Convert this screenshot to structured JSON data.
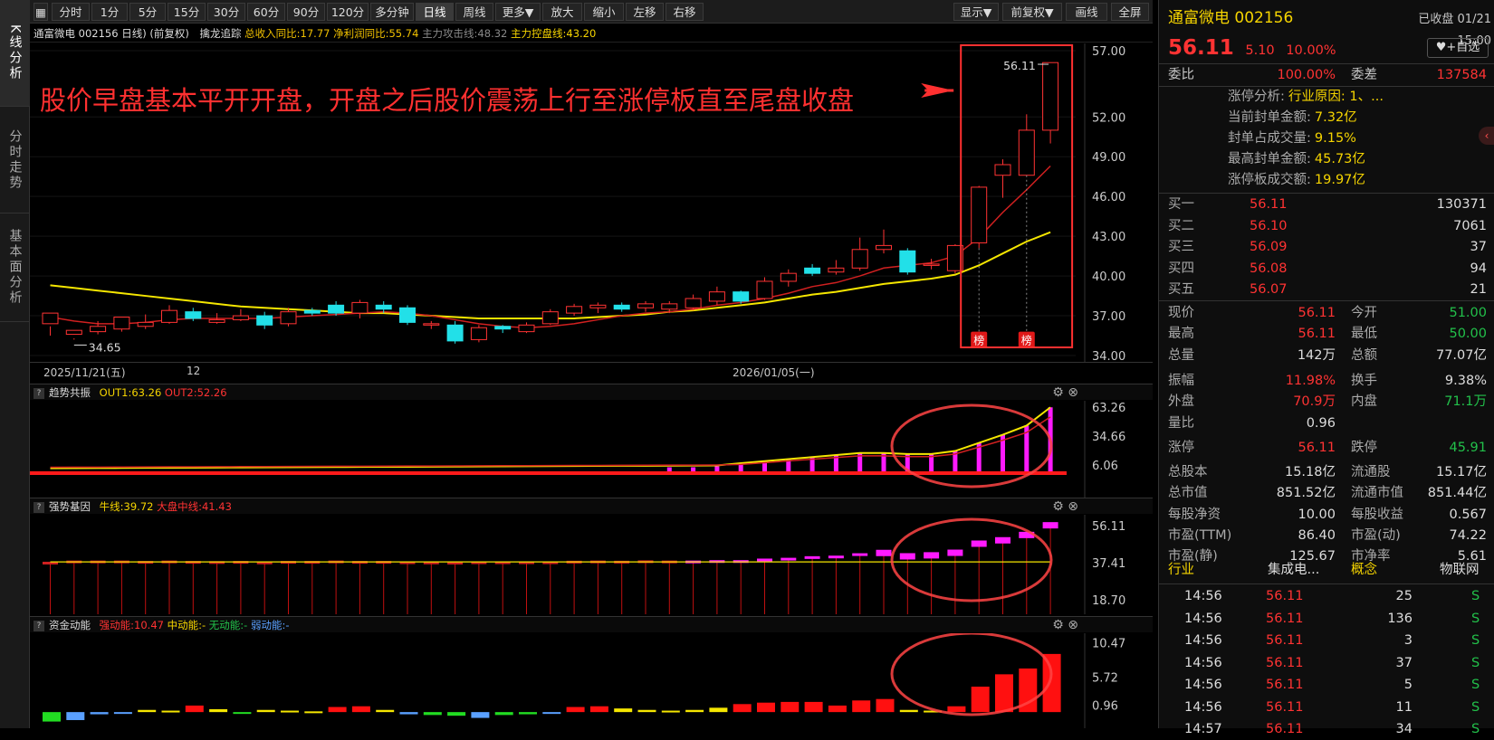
{
  "left_tabs": [
    "K线分析",
    "分时走势",
    "基本面分析"
  ],
  "toolbar": {
    "items": [
      "分时",
      "1分",
      "5分",
      "15分",
      "30分",
      "60分",
      "90分",
      "120分",
      "多分钟",
      "日线",
      "周线",
      "更多▼",
      "放大",
      "缩小",
      "左移",
      "右移"
    ],
    "right_items": [
      "显示▼",
      "前复权▼",
      "画线",
      "全屏"
    ]
  },
  "info": {
    "stock": "通富微电 002156 日线)",
    "adj": "(前复权)",
    "indicator": "擒龙追踪",
    "rev": "总收入同比:17.77",
    "profit": "净利润同比:55.74",
    "attack": "主力攻击线:48.32",
    "control": "主力控盘线:43.20"
  },
  "annotation": "股价早盘基本平开开盘，开盘之后股价震荡上行至涨停板直至尾盘收盘",
  "main": {
    "price_ticks": [
      "57.00",
      "52.00",
      "49.00",
      "46.00",
      "43.00",
      "40.00",
      "37.00",
      "34.00"
    ],
    "last_high": "56.11",
    "low_label": "34.65",
    "badge": "榜",
    "dates": [
      "2025/11/21(五)",
      "12",
      "2026/01/05(一)"
    ]
  },
  "panels": [
    {
      "title": "趋势共振",
      "l1": "OUT1:63.26",
      "l2": "OUT2:52.26",
      "ticks": [
        "63.26",
        "34.66",
        "6.06"
      ]
    },
    {
      "title": "强势基因",
      "l1": "牛线:39.72",
      "l2": "大盘中线:41.43",
      "ticks": [
        "56.11",
        "37.41",
        "18.70"
      ]
    },
    {
      "title": "资金动能",
      "l1": "强动能:10.47",
      "l2": "中动能:-",
      "l3": "无动能:-",
      "l4": "弱动能:-",
      "ticks": [
        "10.47",
        "5.72",
        "0.96"
      ]
    }
  ],
  "quote": {
    "name": "通富微电 002156",
    "status": "已收盘 01/21 15:00",
    "price": "56.11",
    "chg": "5.10",
    "pct": "10.00%",
    "fav": "+自选",
    "ratio_label": "委比",
    "ratio": "100.00%",
    "diff_label": "委差",
    "diff": "137584",
    "zt": [
      [
        "涨停分析:",
        "行业原因: 1、..."
      ],
      [
        "当前封单金额:",
        "7.32亿"
      ],
      [
        "封单占成交量:",
        "9.15%"
      ],
      [
        "最高封单金额:",
        "45.73亿"
      ],
      [
        "涨停板成交额:",
        "19.97亿"
      ]
    ],
    "bids": [
      [
        "买一",
        "56.11",
        "130371"
      ],
      [
        "买二",
        "56.10",
        "7061"
      ],
      [
        "买三",
        "56.09",
        "37"
      ],
      [
        "买四",
        "56.08",
        "94"
      ],
      [
        "买五",
        "56.07",
        "21"
      ]
    ],
    "stats": [
      [
        "现价",
        "56.11",
        "今开",
        "51.00"
      ],
      [
        "最高",
        "56.11",
        "最低",
        "50.00"
      ],
      [
        "总量",
        "142万",
        "总额",
        "77.07亿"
      ],
      [
        "振幅",
        "11.98%",
        "换手",
        "9.38%"
      ],
      [
        "外盘",
        "70.9万",
        "内盘",
        "71.1万"
      ],
      [
        "量比",
        "0.96",
        "",
        ""
      ],
      [
        "涨停",
        "56.11",
        "跌停",
        "45.91"
      ],
      [
        "总股本",
        "15.18亿",
        "流通股",
        "15.17亿"
      ],
      [
        "总市值",
        "851.52亿",
        "流通市值",
        "851.44亿"
      ],
      [
        "每股净资",
        "10.00",
        "每股收益",
        "0.567"
      ],
      [
        "市盈(TTM)",
        "86.40",
        "市盈(动)",
        "74.22"
      ],
      [
        "市盈(静)",
        "125.67",
        "市净率",
        "5.61"
      ]
    ],
    "industry": [
      "行业",
      "集成电...",
      "概念",
      "物联网"
    ],
    "ticks": [
      [
        "14:56",
        "56.11",
        "25",
        "S"
      ],
      [
        "14:56",
        "56.11",
        "136",
        "S"
      ],
      [
        "14:56",
        "56.11",
        "3",
        "S"
      ],
      [
        "14:56",
        "56.11",
        "37",
        "S"
      ],
      [
        "14:56",
        "56.11",
        "5",
        "S"
      ],
      [
        "14:56",
        "56.11",
        "11",
        "S"
      ],
      [
        "14:57",
        "56.11",
        "34",
        "S"
      ]
    ]
  },
  "chart_data": [
    {
      "type": "candlestick",
      "title": "通富微电 002156 日线",
      "ylim": [
        34,
        57
      ],
      "candles": [
        [
          36.4,
          37.2,
          36.2,
          35.5
        ],
        [
          35.6,
          35.9,
          35.3,
          35.2
        ],
        [
          35.8,
          36.2,
          36.6,
          35.6
        ],
        [
          36.0,
          36.9,
          36.9,
          35.8
        ],
        [
          36.2,
          36.5,
          37.1,
          36.0
        ],
        [
          36.5,
          37.4,
          37.8,
          36.4
        ],
        [
          37.3,
          36.8,
          37.6,
          36.6
        ],
        [
          36.5,
          36.7,
          37.2,
          36.4
        ],
        [
          36.7,
          37.0,
          37.5,
          36.6
        ],
        [
          37.0,
          36.3,
          37.3,
          36.0
        ],
        [
          36.4,
          37.3,
          37.6,
          36.2
        ],
        [
          37.4,
          37.2,
          37.6,
          37.0
        ],
        [
          37.8,
          37.2,
          38.1,
          37.0
        ],
        [
          37.2,
          38.0,
          38.2,
          36.8
        ],
        [
          37.8,
          37.5,
          38.1,
          37.2
        ],
        [
          37.6,
          36.5,
          37.8,
          36.3
        ],
        [
          36.3,
          36.4,
          36.6,
          36.0
        ],
        [
          36.3,
          35.1,
          36.6,
          34.9
        ],
        [
          35.2,
          36.1,
          36.3,
          35.0
        ],
        [
          36.2,
          36.0,
          36.3,
          35.7
        ],
        [
          35.8,
          36.3,
          36.5,
          35.7
        ],
        [
          36.4,
          37.3,
          37.5,
          36.3
        ],
        [
          37.2,
          37.7,
          37.9,
          37.0
        ],
        [
          37.6,
          37.8,
          38.0,
          37.2
        ],
        [
          37.8,
          37.5,
          38.0,
          37.3
        ],
        [
          37.6,
          37.9,
          38.1,
          37.3
        ],
        [
          37.5,
          37.9,
          38.1,
          37.2
        ],
        [
          37.6,
          38.3,
          38.6,
          37.4
        ],
        [
          38.1,
          38.8,
          39.2,
          37.8
        ],
        [
          38.8,
          38.1,
          38.9,
          37.9
        ],
        [
          38.3,
          39.6,
          39.9,
          38.2
        ],
        [
          39.6,
          40.2,
          40.5,
          39.2
        ],
        [
          40.6,
          40.2,
          40.9,
          40.0
        ],
        [
          40.3,
          40.6,
          41.2,
          40.1
        ],
        [
          40.6,
          42.0,
          42.9,
          40.4
        ],
        [
          42.0,
          42.3,
          43.5,
          41.7
        ],
        [
          41.9,
          40.3,
          42.1,
          40.1
        ],
        [
          40.9,
          40.9,
          41.3,
          40.5
        ],
        [
          40.4,
          42.3,
          42.4,
          40.2
        ],
        [
          42.5,
          46.7,
          46.8,
          42.1
        ],
        [
          47.6,
          48.4,
          48.8,
          45.9
        ],
        [
          47.6,
          51.0,
          52.2,
          47.6
        ],
        [
          51.0,
          56.1,
          56.1,
          50.0
        ]
      ],
      "ma_yellow": [
        39.3,
        39.1,
        38.9,
        38.7,
        38.5,
        38.3,
        38.1,
        37.9,
        37.7,
        37.6,
        37.5,
        37.4,
        37.3,
        37.2,
        37.2,
        37.1,
        37.0,
        36.9,
        36.8,
        36.8,
        36.8,
        36.8,
        36.8,
        36.9,
        37.0,
        37.1,
        37.3,
        37.4,
        37.6,
        37.8,
        38.0,
        38.3,
        38.6,
        38.8,
        39.1,
        39.4,
        39.6,
        39.8,
        40.1,
        40.8,
        41.7,
        42.6,
        43.3
      ],
      "ma_red": [
        36.9,
        36.6,
        36.4,
        36.4,
        36.5,
        36.7,
        36.8,
        36.8,
        36.8,
        36.8,
        36.9,
        37.0,
        37.1,
        37.2,
        37.3,
        37.2,
        37.0,
        36.7,
        36.4,
        36.2,
        36.1,
        36.2,
        36.4,
        36.7,
        37.0,
        37.2,
        37.3,
        37.5,
        37.8,
        38.0,
        38.3,
        38.7,
        39.2,
        39.5,
        40.0,
        40.6,
        40.8,
        41.0,
        41.5,
        42.9,
        44.8,
        46.5,
        48.3
      ]
    },
    {
      "type": "bar",
      "title": "趋势共振",
      "ylim": [
        0,
        65
      ],
      "values": [
        0,
        0,
        0,
        0,
        0,
        0,
        0,
        0,
        0,
        0,
        0,
        0,
        0,
        0,
        0,
        0,
        0,
        0,
        0,
        0,
        0,
        0,
        0,
        0,
        0,
        0,
        4,
        4,
        5,
        8,
        10,
        12,
        14,
        16,
        18,
        18,
        17,
        17,
        20,
        28,
        36,
        45,
        63
      ]
    },
    {
      "type": "bar",
      "title": "强势基因",
      "ylim": [
        0,
        60
      ],
      "values": [
        37.2,
        37.8,
        37.8,
        37.8,
        37.6,
        37.8,
        37.6,
        37.5,
        37.6,
        37.3,
        37.6,
        37.6,
        37.8,
        37.6,
        37.6,
        37.4,
        37.3,
        37.2,
        37.4,
        37.4,
        37.4,
        37.4,
        37.7,
        37.8,
        37.7,
        37.9,
        37.8,
        37.8,
        38.0,
        38.0,
        38.8,
        39.2,
        40.0,
        40.3,
        41.5,
        42.1,
        40.4,
        40.9,
        42.2,
        46.8,
        48.5,
        51.2,
        56.1
      ]
    },
    {
      "type": "bar",
      "title": "资金动能",
      "ylim": [
        0,
        11
      ],
      "values": [
        -1.3,
        -1.1,
        -0.3,
        -0.2,
        0.3,
        0.2,
        0.9,
        0.4,
        -0.1,
        0.3,
        0.2,
        0.1,
        0.7,
        0.8,
        0.3,
        -0.3,
        -0.4,
        -0.5,
        -0.8,
        -0.4,
        -0.3,
        -0.1,
        0.7,
        0.8,
        0.5,
        0.3,
        0.2,
        0.3,
        0.6,
        1.1,
        1.3,
        1.4,
        1.4,
        0.9,
        1.6,
        1.8,
        0.3,
        0.2,
        0.8,
        3.5,
        5.2,
        6.0,
        8.0
      ]
    }
  ]
}
